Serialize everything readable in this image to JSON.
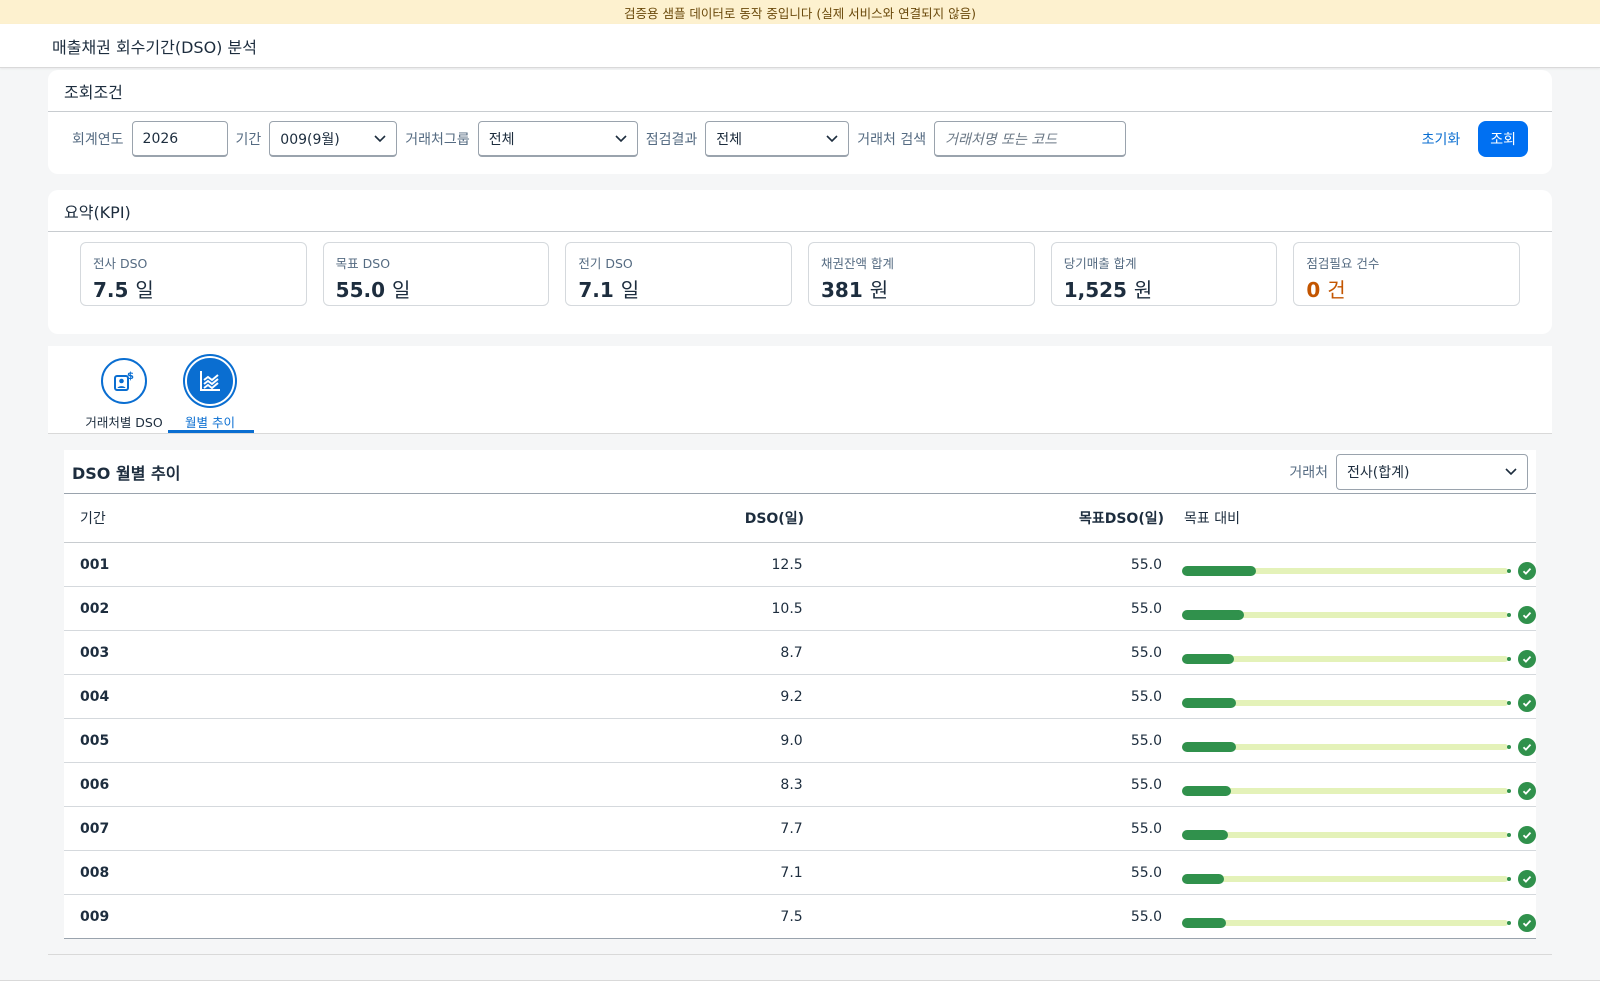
{
  "banner": "검증용 샘플 데이터로 동작 중입니다 (실제 서비스와 연결되지 않음)",
  "app_title": "매출채권 회수기간(DSO) 분석",
  "filters": {
    "title": "조회조건",
    "fiscal_year_label": "회계연도",
    "fiscal_year_value": "2026",
    "period_label": "기간",
    "period_value": "009(9월)",
    "group_label": "거래처그룹",
    "group_value": "전체",
    "check_label": "점검결과",
    "check_value": "전체",
    "search_label": "거래처 검색",
    "search_placeholder": "거래처명 또는 코드",
    "reset_label": "초기화",
    "go_label": "조회"
  },
  "kpi": {
    "title": "요약(KPI)",
    "cards": [
      {
        "label": "전사 DSO",
        "value": "7.5",
        "unit": "일"
      },
      {
        "label": "목표 DSO",
        "value": "55.0",
        "unit": "일"
      },
      {
        "label": "전기 DSO",
        "value": "7.1",
        "unit": "일"
      },
      {
        "label": "채권잔액 합계",
        "value": "381",
        "unit": "원"
      },
      {
        "label": "당기매출 합계",
        "value": "1,525",
        "unit": "원"
      },
      {
        "label": "점검필요 건수",
        "value": "0",
        "unit": "건"
      }
    ],
    "warn_color": "#c35500"
  },
  "tabs": [
    {
      "label": "거래처별 DSO",
      "icon": "customer-money-icon",
      "active": false
    },
    {
      "label": "월별 추이",
      "icon": "line-chart-icon",
      "active": true
    }
  ],
  "trend": {
    "title": "DSO 월별 추이",
    "customer_label": "거래처",
    "customer_value": "전사(합계)",
    "columns": {
      "period": "기간",
      "dso": "DSO(일)",
      "target": "목표DSO(일)",
      "vs_target": "목표 대비"
    },
    "rows": [
      {
        "period": "001",
        "dso": "12.5",
        "target": "55.0",
        "ratio": 0.227
      },
      {
        "period": "002",
        "dso": "10.5",
        "target": "55.0",
        "ratio": 0.191
      },
      {
        "period": "003",
        "dso": "8.7",
        "target": "55.0",
        "ratio": 0.158
      },
      {
        "period": "004",
        "dso": "9.2",
        "target": "55.0",
        "ratio": 0.167
      },
      {
        "period": "005",
        "dso": "9.0",
        "target": "55.0",
        "ratio": 0.164
      },
      {
        "period": "006",
        "dso": "8.3",
        "target": "55.0",
        "ratio": 0.151
      },
      {
        "period": "007",
        "dso": "7.7",
        "target": "55.0",
        "ratio": 0.14
      },
      {
        "period": "008",
        "dso": "7.1",
        "target": "55.0",
        "ratio": 0.129
      },
      {
        "period": "009",
        "dso": "7.5",
        "target": "55.0",
        "ratio": 0.136
      }
    ],
    "bar_color": "#30914c",
    "track_color": "#e4f2b9"
  }
}
